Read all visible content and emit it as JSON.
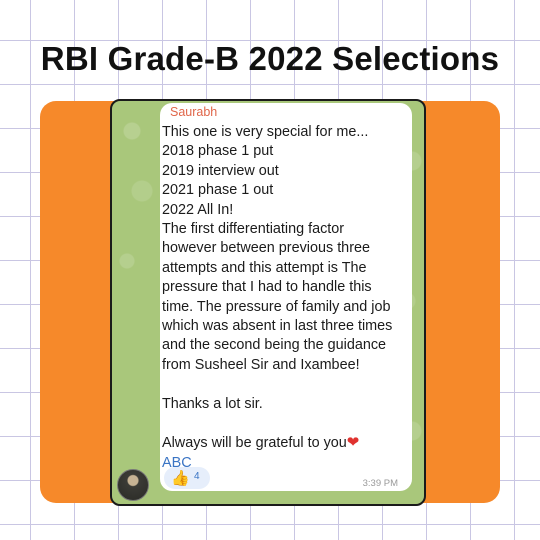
{
  "banner": {
    "title": "RBI Grade-B 2022 Selections"
  },
  "message": {
    "sender": "Saurabh",
    "lines": [
      "This one is very special for me...",
      "2018 phase 1 put",
      "2019 interview out",
      "2021 phase 1 out",
      "2022 All In!",
      "The first differentiating factor",
      "however between previous three",
      "attempts and this attempt is The",
      "pressure that I had to handle this",
      "time. The pressure of family and job",
      "which was absent in last three times",
      "and the second being the guidance",
      "from Susheel Sir and Ixambee!"
    ],
    "thanks": "Thanks a lot sir.",
    "closing": "Always will be grateful to you",
    "heart_icon": "❤",
    "signature": "ABC",
    "reaction_icon": "👍",
    "reaction_count": "4",
    "time": "3:39 PM"
  },
  "colors": {
    "accent_orange": "#f6892a",
    "chat_background": "#a9c77b",
    "sender_name": "#e0664a",
    "link_blue": "#3a74c4"
  }
}
